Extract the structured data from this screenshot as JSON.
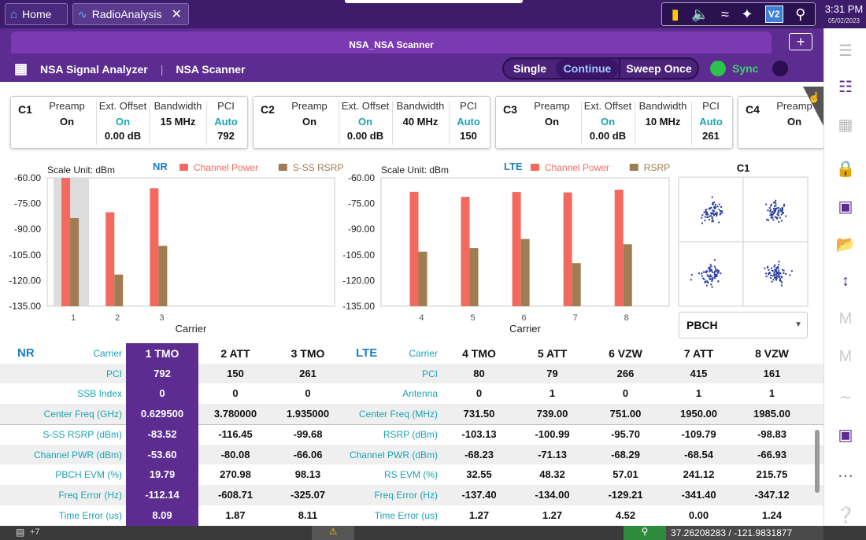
{
  "topbar": {
    "home_label": "Home",
    "app_tab_label": "RadioAnalysis",
    "time": "3:31 PM",
    "date": "05/02/2023",
    "v_badge": "V2"
  },
  "header": {
    "title": "NSA_NSA Scanner",
    "breadcrumb_1": "NSA Signal Analyzer",
    "breadcrumb_2": "NSA Scanner",
    "mode_single": "Single",
    "mode_continue": "Continue",
    "mode_sweep": "Sweep Once",
    "sync_label": "Sync",
    "add_label": "+"
  },
  "cards": [
    {
      "name": "C1",
      "preamp_h": "Preamp",
      "preamp": "On",
      "offset_h": "Ext. Offset",
      "offset_state": "On",
      "offset_val": "0.00 dB",
      "bw_h": "Bandwidth",
      "bw": "15 MHz",
      "pci_h": "PCI",
      "pci_mode": "Auto",
      "pci": "792"
    },
    {
      "name": "C2",
      "preamp_h": "Preamp",
      "preamp": "On",
      "offset_h": "Ext. Offset",
      "offset_state": "On",
      "offset_val": "0.00 dB",
      "bw_h": "Bandwidth",
      "bw": "40 MHz",
      "pci_h": "PCI",
      "pci_mode": "Auto",
      "pci": "150"
    },
    {
      "name": "C3",
      "preamp_h": "Preamp",
      "preamp": "On",
      "offset_h": "Ext. Offset",
      "offset_state": "On",
      "offset_val": "0.00 dB",
      "bw_h": "Bandwidth",
      "bw": "10 MHz",
      "pci_h": "PCI",
      "pci_mode": "Auto",
      "pci": "261"
    },
    {
      "name": "C4",
      "preamp_h": "Preamp",
      "preamp": "On"
    }
  ],
  "chart_data": [
    {
      "type": "bar",
      "title": "NR",
      "scale_unit": "Scale Unit: dBm",
      "xlabel": "Carrier",
      "categories": [
        "1",
        "2",
        "3"
      ],
      "yticks": [
        "-60.00",
        "-75.00",
        "-90.00",
        "-105.00",
        "-120.00",
        "-135.00"
      ],
      "ylim": [
        -135,
        -60
      ],
      "series": [
        {
          "name": "Channel Power",
          "color": "#f26a5e",
          "values": [
            -60,
            -80.1,
            -66.1
          ]
        },
        {
          "name": "S-SS RSRP",
          "color": "#a07c52",
          "values": [
            -83.5,
            -116.5,
            -99.7
          ]
        }
      ],
      "highlight": "1"
    },
    {
      "type": "bar",
      "title": "LTE",
      "scale_unit": "Scale Unit: dBm",
      "xlabel": "Carrier",
      "categories": [
        "4",
        "5",
        "6",
        "7",
        "8"
      ],
      "yticks": [
        "-60.00",
        "-75.00",
        "-90.00",
        "-105.00",
        "-120.00",
        "-135.00"
      ],
      "ylim": [
        -135,
        -60
      ],
      "series": [
        {
          "name": "Channel Power",
          "color": "#f26a5e",
          "values": [
            -68.2,
            -71.1,
            -68.3,
            -68.5,
            -66.9
          ]
        },
        {
          "name": "RSRP",
          "color": "#a07c52",
          "values": [
            -103.1,
            -101.0,
            -95.7,
            -109.8,
            -98.8
          ]
        }
      ]
    }
  ],
  "constellation": {
    "title": "C1",
    "dropdown": "PBCH"
  },
  "nr_table": {
    "tech": "NR",
    "labels": [
      "Carrier",
      "PCI",
      "SSB Index",
      "Center Freq (GHz)",
      "S-SS RSRP (dBm)",
      "Channel PWR (dBm)",
      "PBCH EVM (%)",
      "Freq Error (Hz)",
      "Time Error (us)"
    ],
    "columns": [
      [
        "1 TMO",
        "792",
        "0",
        "0.629500",
        "-83.52",
        "-53.60",
        "19.79",
        "-112.14",
        "8.09"
      ],
      [
        "2 ATT",
        "150",
        "0",
        "3.780000",
        "-116.45",
        "-80.08",
        "270.98",
        "-608.71",
        "1.87"
      ],
      [
        "3 TMO",
        "261",
        "0",
        "1.935000",
        "-99.68",
        "-66.06",
        "98.13",
        "-325.07",
        "8.11"
      ]
    ]
  },
  "lte_table": {
    "tech": "LTE",
    "labels": [
      "Carrier",
      "PCI",
      "Antenna",
      "Center Freq (MHz)",
      "RSRP (dBm)",
      "Channel PWR (dBm)",
      "RS EVM (%)",
      "Freq Error (Hz)",
      "Time Error (us)"
    ],
    "columns": [
      [
        "4 TMO",
        "80",
        "0",
        "731.50",
        "-103.13",
        "-68.23",
        "32.55",
        "-137.40",
        "1.27"
      ],
      [
        "5 ATT",
        "79",
        "1",
        "739.00",
        "-100.99",
        "-71.13",
        "48.32",
        "-134.00",
        "1.27"
      ],
      [
        "6 VZW",
        "266",
        "0",
        "751.00",
        "-95.70",
        "-68.29",
        "57.01",
        "-129.21",
        "4.52"
      ],
      [
        "7 ATT",
        "415",
        "1",
        "1950.00",
        "-109.79",
        "-68.54",
        "241.12",
        "-341.40",
        "0.00"
      ],
      [
        "8 VZW",
        "161",
        "1",
        "1985.00",
        "-98.83",
        "-66.93",
        "215.75",
        "-347.12",
        "1.24"
      ]
    ]
  },
  "bottombar": {
    "notif_count": "+7",
    "gps": "37.26208283 / -121.9831877"
  }
}
